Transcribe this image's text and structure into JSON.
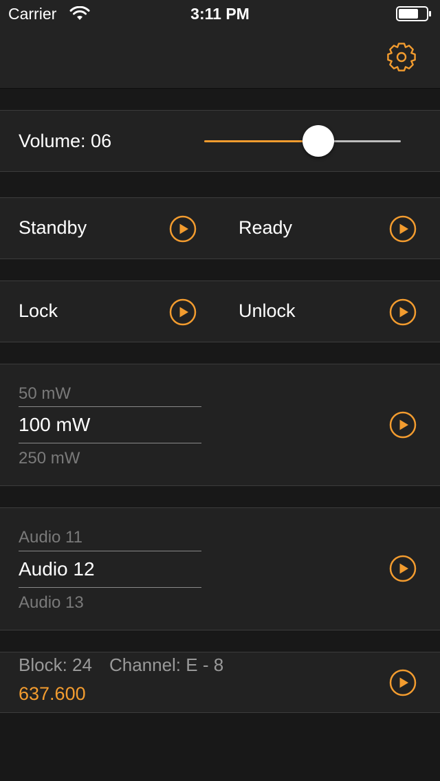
{
  "status_bar": {
    "carrier": "Carrier",
    "time": "3:11 PM",
    "wifi_icon": "wifi-icon",
    "battery_icon": "battery-icon"
  },
  "nav": {
    "settings_icon": "gear-icon"
  },
  "accent_color": "#f39c2f",
  "volume": {
    "label": "Volume: 06",
    "slider_fraction": 0.58
  },
  "rows": {
    "standby_label": "Standby",
    "ready_label": "Ready",
    "lock_label": "Lock",
    "unlock_label": "Unlock"
  },
  "power_picker": {
    "above": "50 mW",
    "selected": "100 mW",
    "below": "250 mW"
  },
  "audio_picker": {
    "above": "Audio 11",
    "selected": "Audio 12",
    "below": "Audio 13"
  },
  "frequency": {
    "block": "Block: 24",
    "channel": "Channel: E - 8",
    "value": "637.600"
  },
  "play_icon": "play-circle-icon"
}
